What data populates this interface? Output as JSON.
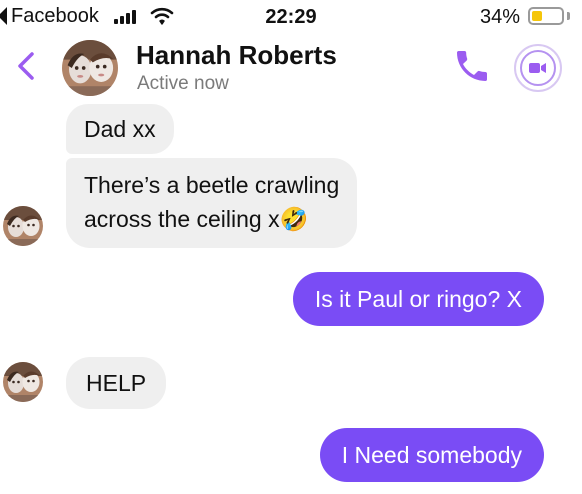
{
  "status_bar": {
    "back_app": "Facebook",
    "time": "22:29",
    "battery_percent": "34%",
    "battery_level": 0.34
  },
  "header": {
    "contact_name": "Hannah Roberts",
    "contact_status": "Active now",
    "icons": [
      "back-chevron-icon",
      "phone-icon",
      "video-camera-icon"
    ],
    "accent_color": "#7a4cf5"
  },
  "messages": [
    {
      "direction": "incoming",
      "text": "Dad xx"
    },
    {
      "direction": "incoming",
      "lines": [
        "There’s a beetle crawling",
        "across the ceiling x"
      ],
      "emoji": "🤣"
    },
    {
      "direction": "outgoing",
      "text": "Is it Paul or ringo? X"
    },
    {
      "direction": "incoming",
      "text": "HELP"
    },
    {
      "direction": "outgoing",
      "text": "I Need somebody"
    }
  ],
  "colors": {
    "incoming_bubble": "#efefef",
    "outgoing_bubble": "#7a4cf5"
  }
}
